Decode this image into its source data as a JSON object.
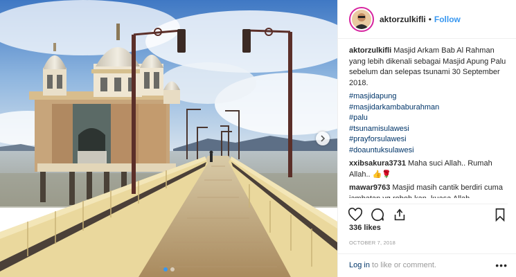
{
  "post": {
    "username": "aktorzulkifli",
    "separator": "•",
    "follow_label": "Follow",
    "caption": "Masjid Arkam Bab Al Rahman yang lebih dikenali sebagai Masjid Apung Palu sebelum dan selepas tsunami 30 September 2018.",
    "hashtags": [
      "#masjidapung",
      "#masjidarkambaburahman",
      "#palu",
      "#tsunamisulawesi",
      "#prayforsulawesi",
      "#doauntuksulawesi"
    ],
    "comments": [
      {
        "user": "xxibsakura3731",
        "text": "Maha suci Allah.. Rumah Allah..",
        "emoji": "👍🌹"
      },
      {
        "user": "mawar9763",
        "text": "Masjid masih cantik berdiri cuma jambatan yg roboh kan..kuasa Allah"
      }
    ],
    "likes": "336 likes",
    "date": "OCTOBER 7, 2018",
    "login_link": "Log in",
    "login_rest": " to like or comment.",
    "more_glyph": "•••"
  },
  "carousel": {
    "slides": 2,
    "active": 0
  },
  "icons": {
    "like": "heart-icon",
    "comment": "comment-icon",
    "share": "share-icon",
    "save": "bookmark-icon",
    "next": "chevron-right-icon"
  },
  "colors": {
    "follow": "#3897f0",
    "hashtag": "#003569",
    "muted": "#999999",
    "text": "#262626"
  }
}
